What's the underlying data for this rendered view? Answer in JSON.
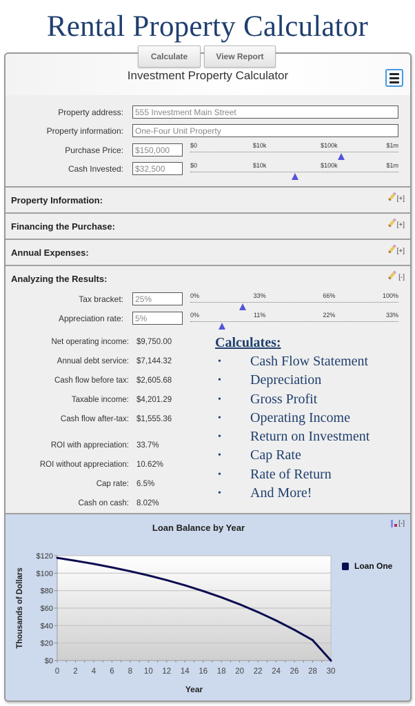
{
  "page_title": "Rental Property Calculator",
  "toolbar": {
    "calculate_label": "Calculate",
    "view_report_label": "View Report"
  },
  "panel": {
    "title": "Investment Property Calculator",
    "menu_icon": "hamburger-menu-icon"
  },
  "fields": {
    "property_address": {
      "label": "Property address:",
      "value": "555 Investment Main Street"
    },
    "property_information": {
      "label": "Property information:",
      "value": "One-Four Unit Property"
    },
    "purchase_price": {
      "label": "Purchase Price:",
      "value": "$150,000",
      "slider": {
        "ticks": [
          "$0",
          "$10k",
          "$100k",
          "$1m"
        ],
        "scale": "log",
        "value": 150000
      }
    },
    "cash_invested": {
      "label": "Cash Invested:",
      "value": "$32,500",
      "slider": {
        "ticks": [
          "$0",
          "$10k",
          "$100k",
          "$1m"
        ],
        "scale": "log",
        "value": 32500
      }
    }
  },
  "sections": [
    {
      "title": "Property Information:",
      "toggle": "[+]"
    },
    {
      "title": "Financing the Purchase:",
      "toggle": "[+]"
    },
    {
      "title": "Annual Expenses:",
      "toggle": "[+]"
    },
    {
      "title": "Analyzing the Results:",
      "toggle": "[-]"
    }
  ],
  "analysis_inputs": {
    "tax_bracket": {
      "label": "Tax bracket:",
      "value": "25%",
      "slider": {
        "ticks": [
          "0%",
          "33%",
          "66%",
          "100%"
        ],
        "min": 0,
        "max": 100,
        "value": 25
      }
    },
    "appreciation_rate": {
      "label": "Appreciation rate:",
      "value": "5%",
      "slider": {
        "ticks": [
          "0%",
          "11%",
          "22%",
          "33%"
        ],
        "min": 0,
        "max": 33,
        "value": 5
      }
    }
  },
  "results": [
    {
      "label": "Net operating income:",
      "value": "$9,750.00"
    },
    {
      "label": "Annual debt service:",
      "value": "$7,144.32"
    },
    {
      "label": "Cash flow before tax:",
      "value": "$2,605.68"
    },
    {
      "label": "Taxable income:",
      "value": "$4,201.29"
    },
    {
      "label": "Cash flow after-tax:",
      "value": "$1,555.36"
    },
    {
      "label": "ROI with appreciation:",
      "value": "33.7%"
    },
    {
      "label": "ROI without appreciation:",
      "value": "10.62%"
    },
    {
      "label": "Cap rate:",
      "value": "6.5%"
    },
    {
      "label": "Cash on cash:",
      "value": "8.02%"
    }
  ],
  "calculates": {
    "heading": "Calculates:",
    "bullet": "•",
    "items": [
      "Cash Flow Statement",
      "Depreciation",
      "Gross Profit",
      "Operating Income",
      "Return on Investment",
      "Cap Rate",
      "Rate of Return",
      "And More!"
    ]
  },
  "chart_toggle": "[-]",
  "chart_data": {
    "type": "line",
    "title": "Loan Balance by Year",
    "xlabel": "Year",
    "ylabel": "Thousands of Dollars",
    "xlim": [
      0,
      30
    ],
    "ylim": [
      0,
      120
    ],
    "xticks": [
      0,
      2,
      4,
      6,
      8,
      10,
      12,
      14,
      16,
      18,
      20,
      22,
      24,
      26,
      28,
      30
    ],
    "yticks": [
      "$0",
      "$20",
      "$40",
      "$60",
      "$80",
      "$100",
      "$120"
    ],
    "ytick_values": [
      0,
      20,
      40,
      60,
      80,
      100,
      120
    ],
    "grid": true,
    "legend": "right",
    "series": [
      {
        "name": "Loan One",
        "color": "#0c0c52",
        "x": [
          0,
          2,
          4,
          6,
          8,
          10,
          12,
          14,
          16,
          18,
          20,
          22,
          24,
          26,
          28,
          30
        ],
        "values": [
          117.5,
          114.2,
          110.6,
          106.6,
          102.2,
          97.4,
          92.0,
          86.1,
          79.5,
          72.3,
          64.3,
          55.5,
          45.8,
          35.1,
          23.3,
          0.0
        ]
      }
    ]
  }
}
